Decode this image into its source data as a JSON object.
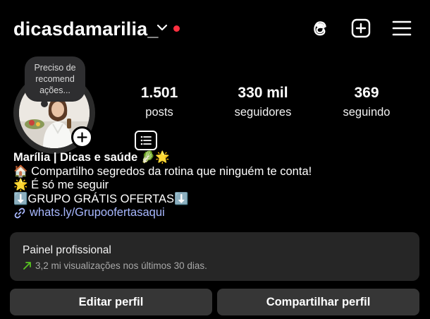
{
  "header": {
    "username": "dicasdamarilia_",
    "icons": [
      "chevron-down-icon",
      "threads-icon",
      "create-icon",
      "menu-icon"
    ],
    "notification_dot_color": "#ff3040"
  },
  "profile": {
    "note_text": "Preciso de recomend ações...",
    "stats": [
      {
        "value": "1.501",
        "label": "posts"
      },
      {
        "value": "330 mil",
        "label": "seguidores"
      },
      {
        "value": "369",
        "label": "seguindo"
      }
    ]
  },
  "bio": {
    "name": "Marília | Dicas e saúde 🥬🌟",
    "line1": "🏠 Compartilho segredos da rotina que ninguém te conta!",
    "line2": "🌟 É só me seguir",
    "line3": "⬇️GRUPO GRÁTIS OFERTAS⬇️",
    "link": "whats.ly/Grupoofertasaqui",
    "link_color": "#a8b8ff"
  },
  "professional_panel": {
    "title": "Painel profissional",
    "subtitle": "3,2 mi visualizações nos últimos 30 dias.",
    "trend_color": "#58c322"
  },
  "actions": {
    "edit_label": "Editar perfil",
    "share_label": "Compartilhar perfil"
  }
}
